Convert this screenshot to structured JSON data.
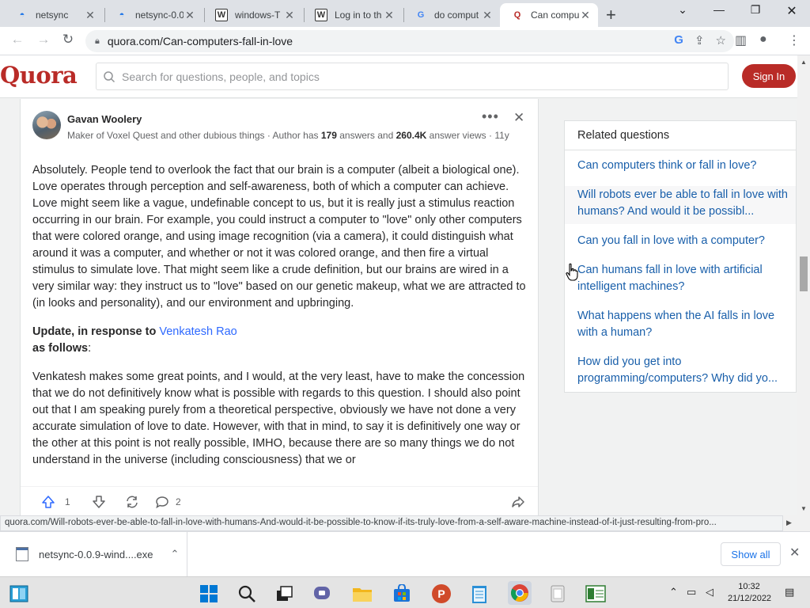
{
  "browser": {
    "tabs": [
      {
        "title": "netsync",
        "icon": "netsync-icon"
      },
      {
        "title": "netsync-0.0",
        "icon": "netsync-icon"
      },
      {
        "title": "windows-T",
        "icon": "wikipedia-icon"
      },
      {
        "title": "Log in to th",
        "icon": "wikipedia-icon"
      },
      {
        "title": "do comput",
        "icon": "google-icon"
      },
      {
        "title": "Can compu",
        "icon": "quora-icon",
        "active": true
      }
    ],
    "url": "quora.com/Can-computers-fall-in-love"
  },
  "quora": {
    "logo": "Quora",
    "search_placeholder": "Search for questions, people, and topics",
    "signin_label": "Sign In",
    "brand_color": "#b92b27"
  },
  "answer": {
    "author": "Gavan Woolery",
    "credential_prefix": "Maker of Voxel Quest and other dubious things · Author has ",
    "answers_count": "179",
    "credential_mid": " answers and ",
    "views_count": "260.4K",
    "credential_suffix": " answer views ·",
    "age": "11y",
    "paragraph1": "Absolutely. People tend to overlook the fact that our brain is a computer (albeit a biological one). Love operates through perception and self-awareness, both of which a computer can achieve. Love might seem like a vague, undefinable concept to us, but it is really just a stimulus reaction occurring in our brain. For example, you could instruct a computer to \"love\" only other computers that were colored orange, and using image recognition (via a camera), it could distinguish what around it was a computer, and whether or not it was colored orange, and then fire a virtual stimulus to simulate love. That might seem like a crude definition, but our brains are wired in a very similar way: they instruct us to \"love\" based on our genetic makeup, what we are attracted to (in looks and personality), and our environment and upbringing.",
    "update_prefix": "Update, in response to ",
    "update_link": "Venkatesh Rao",
    "update_suffix_bold": "as follows",
    "update_colon": ":",
    "paragraph2": "Venkatesh makes some great points, and I would, at the very least, have to make the concession that we do not definitively know what is possible with regards to this question. I should also point out that I am speaking purely from a theoretical perspective, obviously we have not done a very accurate simulation of love to date. However, with that in mind, to say it is definitively one way or the other at this point is not really possible, IMHO, because there are so many things we do not understand in the universe (including consciousness) that we or",
    "upvotes": "1",
    "comments": "2"
  },
  "related": {
    "heading": "Related questions",
    "items": [
      "Can computers think or fall in love?",
      "Will robots ever be able to fall in love with humans? And would it be possibl...",
      "Can you fall in love with a computer?",
      "Can humans fall in love with artificial intelligent machines?",
      "What happens when the AI falls in love with a human?",
      "How did you get into programming/computers? Why did yo..."
    ]
  },
  "status_url": "quora.com/Will-robots-ever-be-able-to-fall-in-love-with-humans-And-would-it-be-possible-to-know-if-its-truly-love-from-a-self-aware-machine-instead-of-it-just-resulting-from-pro...",
  "download": {
    "filename": "netsync-0.0.9-wind....exe",
    "show_all": "Show all"
  },
  "taskbar": {
    "time": "10:32",
    "date": "21/12/2022"
  }
}
